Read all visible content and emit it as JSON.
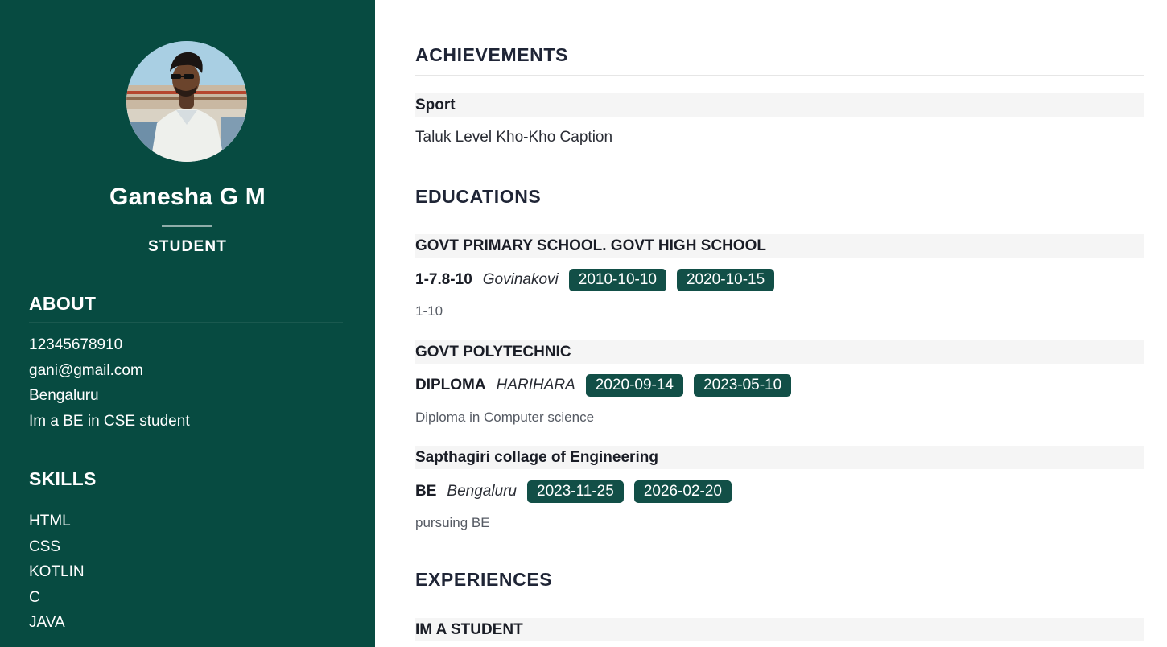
{
  "profile": {
    "name": "Ganesha G M",
    "role": "STUDENT"
  },
  "about": {
    "title": "ABOUT",
    "items": [
      "12345678910",
      "gani@gmail.com",
      "Bengaluru",
      "Im a BE in CSE student"
    ]
  },
  "skills": {
    "title": "SKILLS",
    "items": [
      "HTML",
      "CSS",
      "KOTLIN",
      "C",
      "JAVA"
    ]
  },
  "achievements": {
    "title": "ACHIEVEMENTS",
    "items": [
      {
        "category": "Sport",
        "text": "Taluk Level Kho-Kho Caption"
      }
    ]
  },
  "educations": {
    "title": "EDUCATIONS",
    "items": [
      {
        "school": "GOVT PRIMARY SCHOOL. GOVT HIGH SCHOOL",
        "degree": "1-7.8-10",
        "place": "Govinakovi",
        "start": "2010-10-10",
        "end": "2020-10-15",
        "description": "1-10"
      },
      {
        "school": "GOVT POLYTECHNIC",
        "degree": "DIPLOMA",
        "place": "HARIHARA",
        "start": "2020-09-14",
        "end": "2023-05-10",
        "description": "Diploma in Computer science"
      },
      {
        "school": "Sapthagiri collage of Engineering",
        "degree": "BE",
        "place": "Bengaluru",
        "start": "2023-11-25",
        "end": "2026-02-20",
        "description": "pursuing BE"
      }
    ]
  },
  "experiences": {
    "title": "EXPERIENCES",
    "items": [
      {
        "title": "IM A STUDENT"
      }
    ]
  },
  "colors": {
    "sidebar_bg": "#074b41",
    "date_chip_bg": "#124f47",
    "item_header_bg": "#f5f5f5"
  }
}
